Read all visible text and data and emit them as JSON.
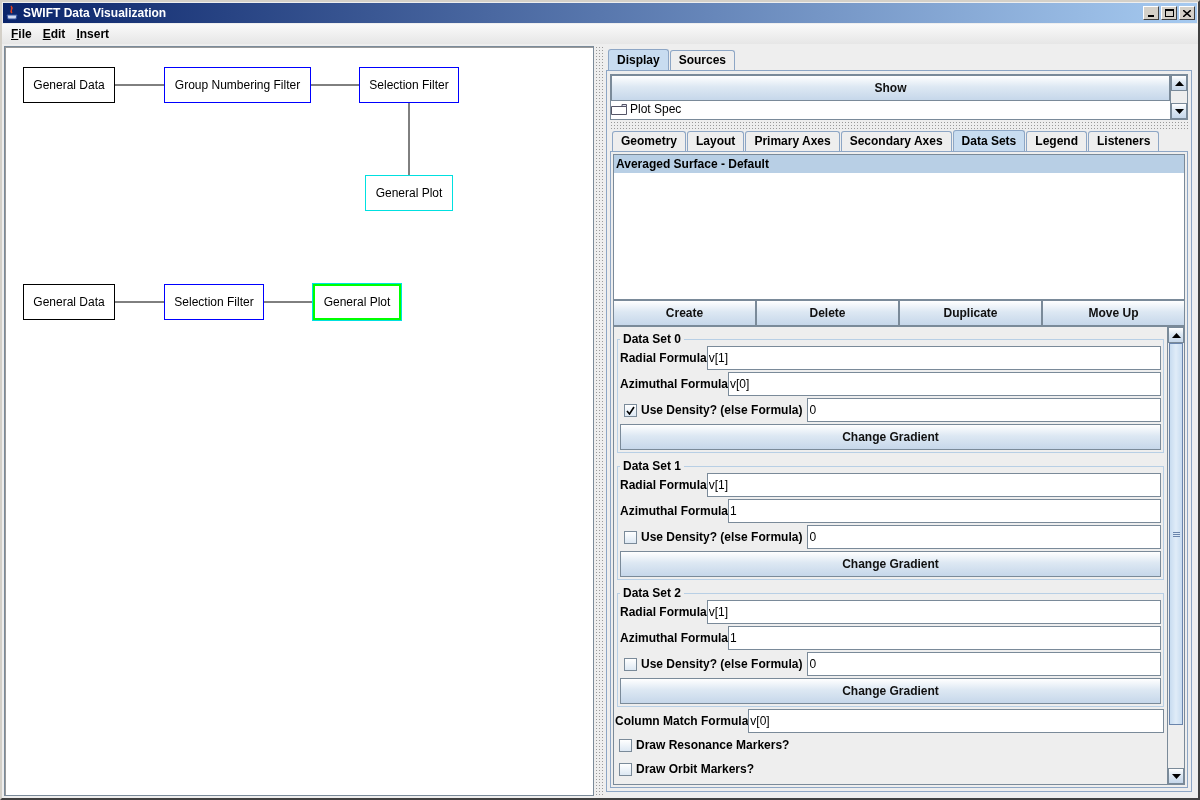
{
  "window": {
    "title": "SWIFT Data Visualization"
  },
  "menu": [
    {
      "label": "File"
    },
    {
      "label": "Edit"
    },
    {
      "label": "Insert"
    }
  ],
  "diagrams": [
    {
      "nodes": [
        {
          "label": "General Data",
          "color": "#000000",
          "selected": false
        },
        {
          "label": "Group Numbering Filter",
          "color": "#0000ff",
          "selected": false
        },
        {
          "label": "Selection Filter",
          "color": "#0000ff",
          "selected": false
        },
        {
          "label": "General Plot",
          "color": "#00e0e0",
          "selected": false
        }
      ]
    },
    {
      "nodes": [
        {
          "label": "General Data",
          "color": "#000000",
          "selected": false
        },
        {
          "label": "Selection Filter",
          "color": "#0000ff",
          "selected": false
        },
        {
          "label": "General Plot",
          "color": "#00e0e0",
          "selected": true
        }
      ]
    }
  ],
  "display_tabs": [
    {
      "label": "Display",
      "selected": true
    },
    {
      "label": "Sources",
      "selected": false
    }
  ],
  "show_button": "Show",
  "tree_items": [
    {
      "label": "Plot Spec"
    }
  ],
  "plot_tabs": [
    {
      "label": "Geometry",
      "selected": false
    },
    {
      "label": "Layout",
      "selected": false
    },
    {
      "label": "Primary Axes",
      "selected": false
    },
    {
      "label": "Secondary Axes",
      "selected": false
    },
    {
      "label": "Data Sets",
      "selected": true
    },
    {
      "label": "Legend",
      "selected": false
    },
    {
      "label": "Listeners",
      "selected": false
    }
  ],
  "data_set_list": [
    {
      "label": "Averaged Surface - Default",
      "selected": true
    }
  ],
  "list_buttons": [
    "Create",
    "Delete",
    "Duplicate",
    "Move Up"
  ],
  "data_sets": [
    {
      "title": "Data Set 0",
      "radial_label": "Radial Formula",
      "radial": "v[1]",
      "azimuthal_label": "Azimuthal Formula",
      "azimuthal": "v[0]",
      "density_label": "Use Density? (else Formula)",
      "use_density": true,
      "density_value": "0",
      "gradient_button": "Change Gradient"
    },
    {
      "title": "Data Set 1",
      "radial_label": "Radial Formula",
      "radial": "v[1]",
      "azimuthal_label": "Azimuthal Formula",
      "azimuthal": "1",
      "density_label": "Use Density? (else Formula)",
      "use_density": false,
      "density_value": "0",
      "gradient_button": "Change Gradient"
    },
    {
      "title": "Data Set 2",
      "radial_label": "Radial Formula",
      "radial": "v[1]",
      "azimuthal_label": "Azimuthal Formula",
      "azimuthal": "1",
      "density_label": "Use Density? (else Formula)",
      "use_density": false,
      "density_value": "0",
      "gradient_button": "Change Gradient"
    }
  ],
  "column_match": {
    "label": "Column Match Formula",
    "value": "v[0]"
  },
  "options": [
    {
      "label": "Draw Resonance Markers?",
      "checked": false
    },
    {
      "label": "Draw Orbit Markers?",
      "checked": false
    }
  ]
}
